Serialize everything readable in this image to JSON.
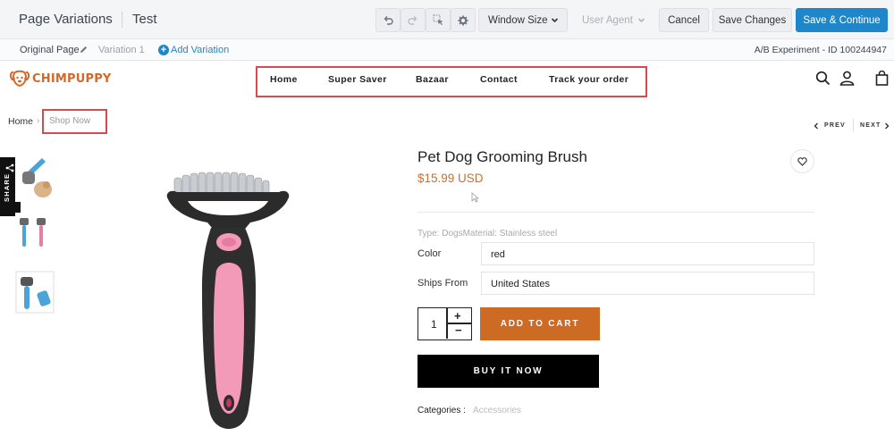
{
  "editor": {
    "title": "Page Variations",
    "test_name": "Test",
    "window_size": "Window Size",
    "user_agent": "User Agent",
    "cancel": "Cancel",
    "save_changes": "Save Changes",
    "save_continue": "Save & Continue",
    "accent_color": "#1f87c9"
  },
  "variations": {
    "original": "Original Page",
    "variation_1": "Variation 1",
    "add": "Add Variation",
    "experiment": "A/B Experiment - ID 100244947"
  },
  "store": {
    "logo": "CHIMPUPPY",
    "nav": [
      "Home",
      "Super Saver",
      "Bazaar",
      "Contact",
      "Track your order"
    ],
    "header_icons": [
      "search-icon",
      "user-icon",
      "bag-icon"
    ]
  },
  "breadcrumb": {
    "home": "Home",
    "current": "Shop Now"
  },
  "pager": {
    "prev": "PREV",
    "next": "NEXT"
  },
  "share": "SHARE",
  "product": {
    "title": "Pet Dog Grooming Brush",
    "price": "$15.99 USD",
    "meta": "Type: DogsMaterial: Stainless steel",
    "color_label": "Color",
    "color_value": "red",
    "ships_label": "Ships From",
    "ships_value": "United States",
    "quantity": "1",
    "add_to_cart": "ADD TO CART",
    "buy_now": "BUY IT NOW",
    "categories_label": "Categories :",
    "categories_value": "Accessories",
    "price_color": "#c9712e",
    "cart_color": "#cd6a24"
  }
}
